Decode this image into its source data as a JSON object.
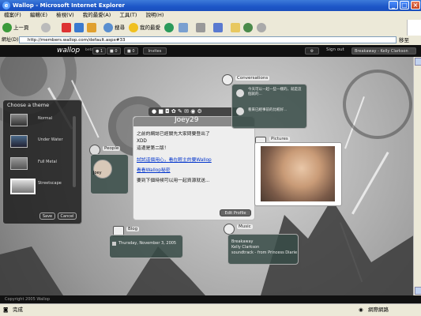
{
  "window": {
    "title": "Wallop - Microsoft Internet Explorer"
  },
  "menu": [
    "檔案(F)",
    "編輯(E)",
    "檢視(V)",
    "我的最愛(A)",
    "工具(T)",
    "說明(H)"
  ],
  "toolbar": {
    "back": "上一頁",
    "search": "搜尋",
    "favorites": "我的最愛"
  },
  "address": {
    "label": "網址(D)",
    "url": "http://members.wallop.com/default.aspx#33",
    "go": "移至"
  },
  "app": {
    "logo": "wallop",
    "beta": "beta",
    "counts": [
      "1",
      "0",
      "0"
    ],
    "invites": "Invites",
    "sign_out": "Sign out",
    "now_playing": "Breakaway - Kelly Clarkson"
  },
  "theme_panel": {
    "title": "Choose a theme",
    "themes": [
      "Normal",
      "Under Water",
      "Full Metal",
      "Streetscape"
    ],
    "save": "Save",
    "cancel": "Cancel"
  },
  "profile": {
    "name": "Joey29",
    "line1": "之前的網誌已經關先大家問要登出了",
    "line2": "XDD",
    "line3": "這邊是第二版！",
    "link1": "試試這個用心，看在輕主的要Wallop",
    "link2": "看看Wallop秘密",
    "line4": "要到下個時候可以用一起資源就送...",
    "edit": "Edit Profile"
  },
  "labels": {
    "people": "People",
    "conversations": "Conversations",
    "pictures": "Pictures",
    "blog": "Blog",
    "music": "Music"
  },
  "people": {
    "name": "Joey"
  },
  "conversations": {
    "items": [
      "今天可以一起一些一樣的，就是這個就的...",
      "看來已經事前的比較好..."
    ]
  },
  "blog": {
    "date": "Thursday, November 3, 2005"
  },
  "music": {
    "title": "Breakaway",
    "artist": "Kelly Clarkson",
    "album": "soundtrack - from Princess Diarie"
  },
  "footer": {
    "copyright": "Copyright 2005 Wallop"
  },
  "status": {
    "left": "完成",
    "zone": "網際網路"
  }
}
